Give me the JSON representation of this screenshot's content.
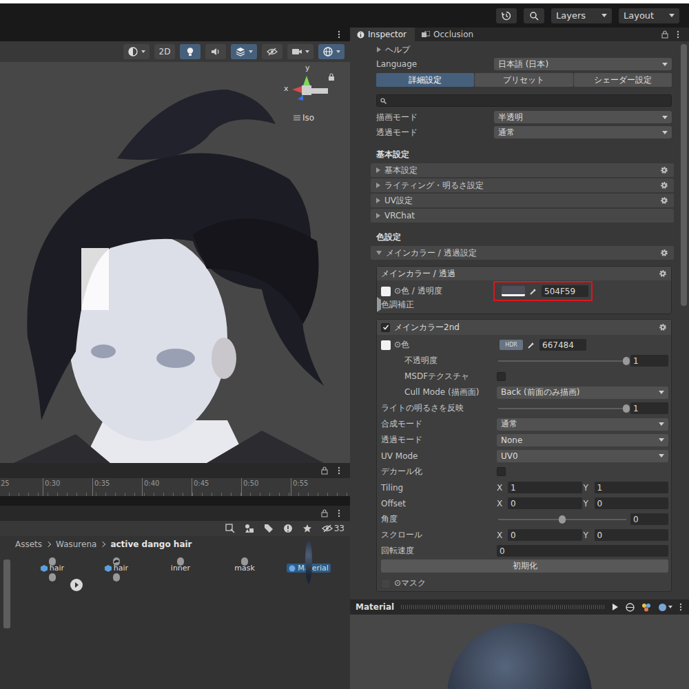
{
  "top_bar": {
    "buttons": [
      {
        "label": "Layers"
      },
      {
        "label": "Layout"
      }
    ]
  },
  "scene": {
    "toolbar": [
      {
        "kind": "shading",
        "active": false
      },
      {
        "kind": "mode2d",
        "label": "2D",
        "active": false
      },
      {
        "kind": "lighting",
        "active": true
      },
      {
        "kind": "audio",
        "active": false
      },
      {
        "kind": "effects",
        "active": true
      },
      {
        "kind": "visibility",
        "active": false
      },
      {
        "kind": "camera",
        "active": false
      },
      {
        "kind": "gizmos",
        "active": true
      }
    ],
    "gizmo": {
      "axes": [
        {
          "label": "y"
        },
        {
          "label": "x"
        }
      ],
      "projection": "Iso"
    }
  },
  "timeline": {
    "ticks": [
      "25",
      "0:30",
      "0:35",
      "0:40",
      "0:45",
      "0:50",
      "0:55"
    ]
  },
  "project": {
    "hidden_count": "33",
    "breadcrumb": [
      {
        "label": "Assets",
        "current": false
      },
      {
        "label": "Wasurena",
        "current": false
      },
      {
        "label": "active dango hair",
        "current": true
      }
    ],
    "assets": [
      {
        "label": "hair",
        "kind": "model",
        "expandable": true,
        "selected": false
      },
      {
        "label": "hair",
        "kind": "mesh",
        "expandable": false,
        "selected": false
      },
      {
        "label": "inner",
        "kind": "texture",
        "expandable": false,
        "selected": false
      },
      {
        "label": "mask",
        "kind": "mask",
        "expandable": false,
        "selected": false
      },
      {
        "label": "Material",
        "kind": "material",
        "expandable": false,
        "selected": true
      },
      {
        "kind": "normalmap",
        "expandable": false,
        "selected": false
      },
      {
        "kind": "pattern",
        "expandable": false,
        "selected": false
      }
    ]
  },
  "inspector": {
    "tabs": [
      {
        "label": "Inspector",
        "selected": true
      },
      {
        "label": "Occlusion",
        "selected": false
      }
    ],
    "help": {
      "label": "ヘルプ",
      "expanded": false
    },
    "language": {
      "label": "Language",
      "value": "日本語 (日本)"
    },
    "modes": [
      {
        "label": "詳細設定",
        "selected": true
      },
      {
        "label": "プリセット",
        "selected": false
      },
      {
        "label": "シェーダー設定",
        "selected": false
      }
    ],
    "render": [
      {
        "label": "描画モード",
        "value": "半透明"
      },
      {
        "label": "透過モード",
        "value": "通常"
      }
    ],
    "groups": [
      {
        "title": "基本設定",
        "sections": [
          {
            "label": "基本設定",
            "expanded": false,
            "menu": true
          },
          {
            "label": "ライティング・明るさ設定",
            "expanded": false,
            "menu": true
          },
          {
            "label": "UV設定",
            "expanded": false,
            "menu": true
          },
          {
            "label": "VRChat",
            "expanded": false,
            "menu": false
          }
        ]
      },
      {
        "title": "色設定",
        "sections": [
          {
            "label": "メインカラー / 透過設定",
            "expanded": true,
            "menu": true
          }
        ]
      }
    ],
    "main_color": {
      "title": "メインカラー / 透過",
      "label": "⊙色 / 透明度",
      "hex": "504F59",
      "highlighted": true,
      "adjust": {
        "label": "色調補正",
        "expanded": false
      }
    },
    "second": {
      "title": "メインカラー2nd",
      "enabled": true,
      "rows": [
        {
          "kind": "color",
          "label": "⊙色",
          "badge": "HDR",
          "hex": "667484",
          "children": [
            {
              "kind": "slider",
              "label": "不透明度",
              "level": 1,
              "value": "1"
            },
            {
              "kind": "checkbox",
              "label": "MSDFテクスチャ",
              "checked": false
            },
            {
              "kind": "dropdown",
              "label": "Cull Mode (描画面)",
              "value": "Back (前面のみ描画)"
            }
          ]
        },
        {
          "kind": "slider",
          "label": "ライトの明るさを反映",
          "level": 1,
          "value": "1"
        },
        {
          "kind": "dropdown",
          "label": "合成モード",
          "value": "通常"
        },
        {
          "kind": "dropdown",
          "label": "透過モード",
          "value": "None"
        },
        {
          "kind": "dropdown",
          "label": "UV Mode",
          "value": "UV0"
        },
        {
          "kind": "checkbox",
          "label": "デカール化",
          "checked": false
        },
        {
          "kind": "vector",
          "label": "Tiling",
          "fields": [
            {
              "axis": "X",
              "value": "1"
            },
            {
              "axis": "Y",
              "value": "1"
            }
          ]
        },
        {
          "kind": "vector",
          "label": "Offset",
          "fields": [
            {
              "axis": "X",
              "value": "0"
            },
            {
              "axis": "Y",
              "value": "0"
            }
          ]
        },
        {
          "kind": "slider",
          "label": "角度",
          "level": 0.5,
          "value": "0"
        },
        {
          "kind": "vector",
          "label": "スクロール",
          "fields": [
            {
              "axis": "X",
              "value": "0"
            },
            {
              "axis": "Y",
              "value": "0"
            }
          ]
        },
        {
          "kind": "number",
          "label": "回転速度",
          "value": "0"
        },
        {
          "kind": "button",
          "label": "初期化"
        },
        {
          "kind": "texture",
          "label": "⊙マスク"
        }
      ]
    }
  },
  "preview": {
    "title": "Material"
  }
}
